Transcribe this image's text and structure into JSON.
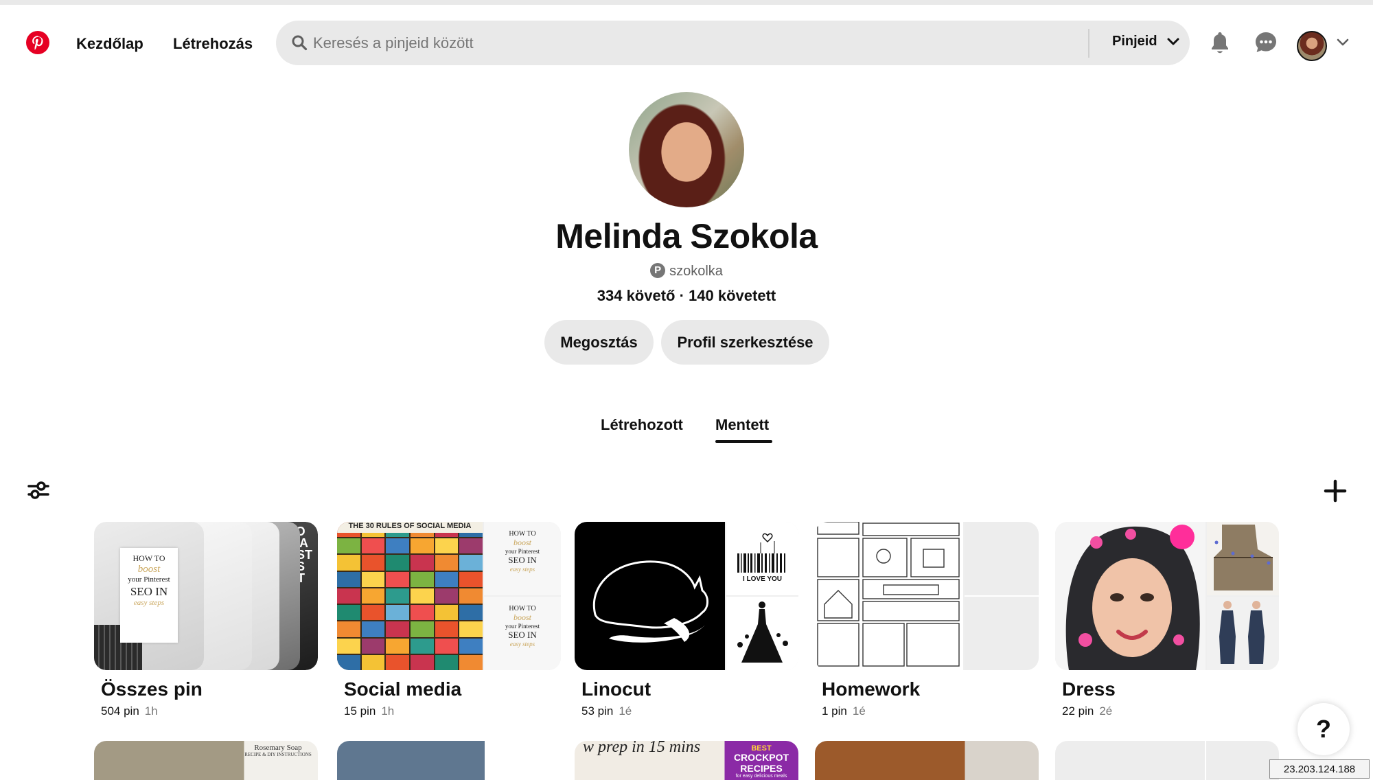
{
  "header": {
    "nav_home": "Kezdőlap",
    "nav_create": "Létrehozás",
    "search_placeholder": "Keresés a pinjeid között",
    "search_scope": "Pinjeid",
    "icons": [
      "pinterest-logo-icon",
      "search-icon",
      "chevron-down-icon",
      "bell-icon",
      "chat-icon",
      "avatar",
      "chevron-down-icon"
    ]
  },
  "profile": {
    "name": "Melinda Szokola",
    "handle": "szokolka",
    "followers": "334 követő",
    "separator": " · ",
    "following": "140 követett",
    "share_label": "Megosztás",
    "edit_label": "Profil szerkesztése"
  },
  "tabs": {
    "created": "Létrehozott",
    "saved": "Mentett",
    "active": "saved"
  },
  "boards": [
    {
      "title": "Összes pin",
      "count": "504 pin",
      "age": "1h"
    },
    {
      "title": "Social media",
      "count": "15 pin",
      "age": "1h"
    },
    {
      "title": "Linocut",
      "count": "53 pin",
      "age": "1é"
    },
    {
      "title": "Homework",
      "count": "1 pin",
      "age": "1é"
    },
    {
      "title": "Dress",
      "count": "22 pin",
      "age": "2é"
    }
  ],
  "cover_text": {
    "seo_how_to": "HOW TO",
    "seo_boost": "boost",
    "seo_your": "your Pinterest",
    "seo_in": "SEO IN",
    "seo_easy": "easy steps",
    "dark_card": "TO\nP A\nEST\nSS\nNT",
    "social_rules": "THE 30 RULES OF SOCIAL MEDIA",
    "love_you": "I LOVE YOU",
    "soap": "Rosemary Soap",
    "soap_sub": "RECIPE & DIY INSTRUCTIONS",
    "meal_prep": "w prep in 15 mins",
    "crockpot_best": "BEST",
    "crockpot": "CROCKPOT RECIPES",
    "crockpot_sub": "for easy delicious meals"
  },
  "help_label": "?",
  "ip_address": "23.203.124.188",
  "colors": {
    "brand": "#e60023",
    "chip_bg": "#e9e9e9",
    "text": "#111111",
    "muted": "#767676"
  }
}
